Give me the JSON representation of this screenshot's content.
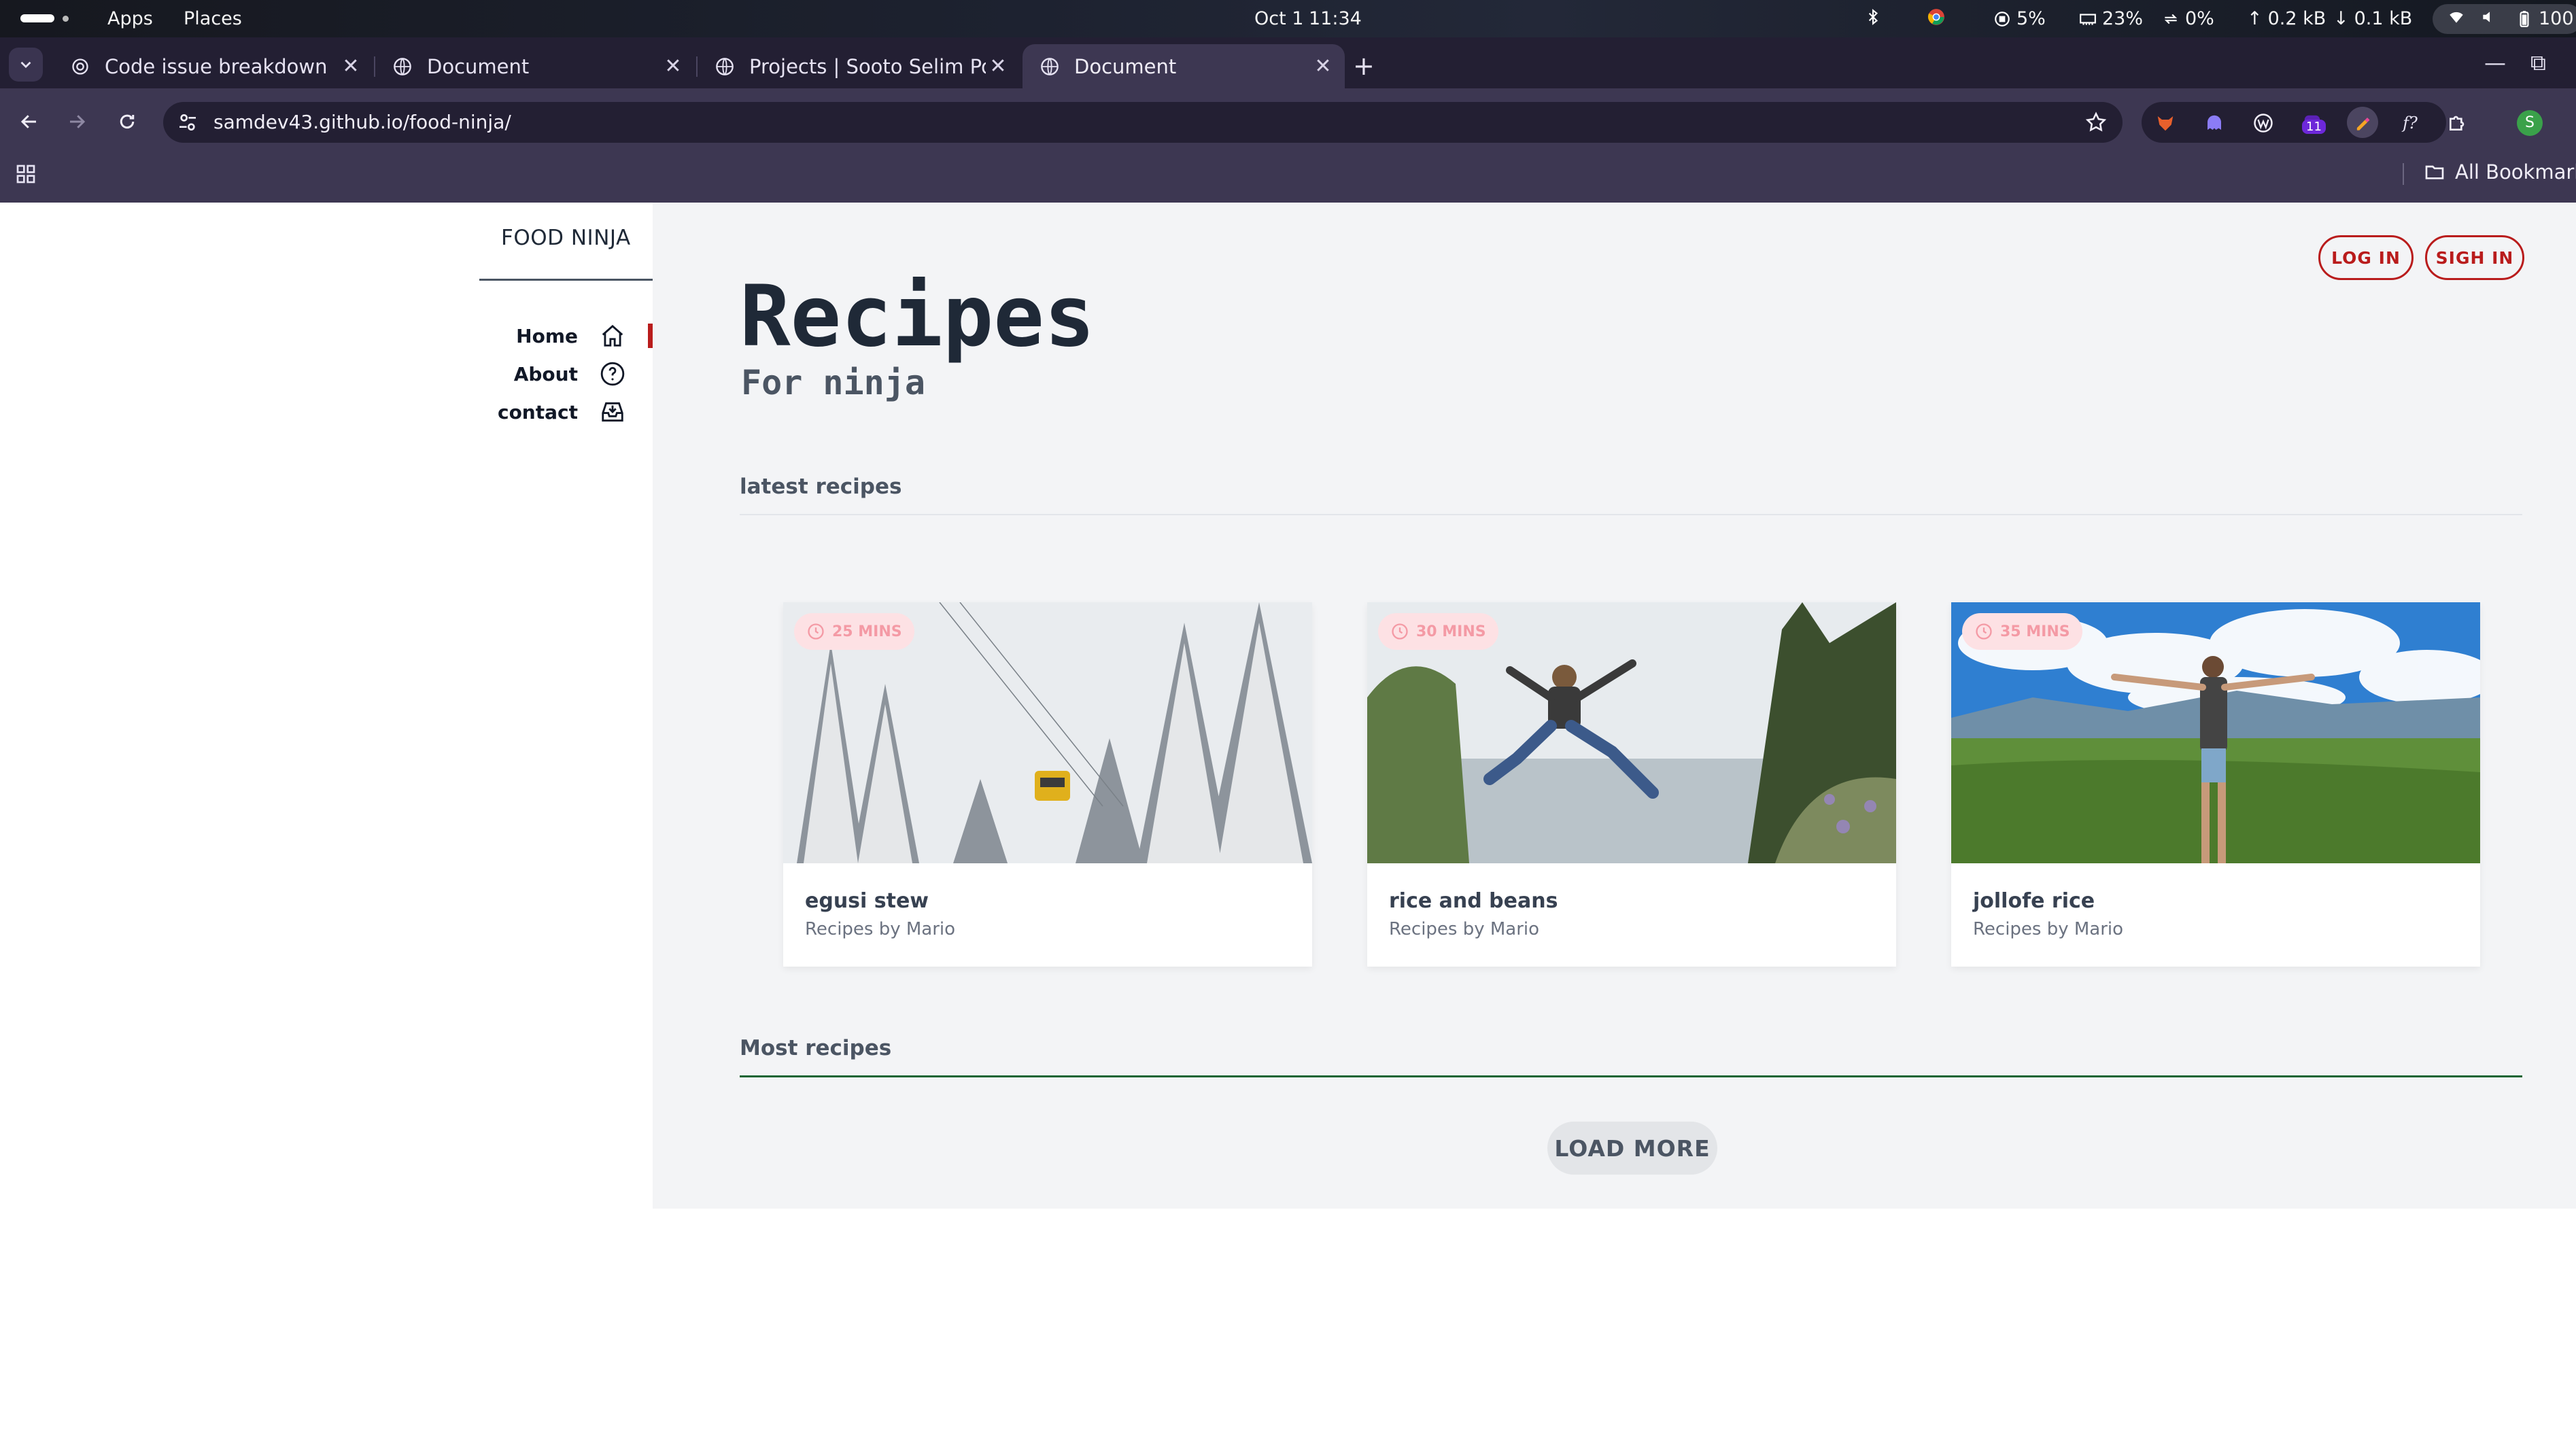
{
  "os_bar": {
    "apps": "Apps",
    "places": "Places",
    "date": "Oct 1",
    "time": "11:34",
    "cpu": "5%",
    "memory": "23%",
    "swap": "0%",
    "upload": "0.2 kB",
    "download": "0.1 kB",
    "battery": "100"
  },
  "browser": {
    "tabs": [
      {
        "title": "Code issue breakdown",
        "active": false
      },
      {
        "title": "Document",
        "active": false
      },
      {
        "title": "Projects | Sooto Selim Po",
        "active": false
      },
      {
        "title": "Document",
        "active": true
      }
    ],
    "url": "samdev43.github.io/food-ninja/",
    "extension_badge": "11",
    "profile_initial": "S",
    "all_bookmarks": "All Bookmarks"
  },
  "site": {
    "brand": "FOOD NINJA",
    "nav": [
      {
        "label": "Home",
        "icon": "home-icon",
        "active": true
      },
      {
        "label": "About",
        "icon": "help-circle-icon",
        "active": false
      },
      {
        "label": "contact",
        "icon": "inbox-icon",
        "active": false
      }
    ],
    "login_label": "LOG IN",
    "signin_label": "SIGH IN",
    "title": "Recipes",
    "subtitle": "For ninja",
    "latest_heading": "latest recipes",
    "most_heading": "Most recipes",
    "load_more": "LOAD MORE",
    "accent_color": "#b91c1c",
    "recipes": [
      {
        "time": "25 MINS",
        "title": "egusi stew",
        "author": "Recipes by Mario",
        "image": "snowy-forest-cable-car"
      },
      {
        "time": "30 MINS",
        "title": "rice and beans",
        "author": "Recipes by Mario",
        "image": "person-jumping-lake"
      },
      {
        "time": "35 MINS",
        "title": "jollofe rice",
        "author": "Recipes by Mario",
        "image": "person-mountain-view"
      }
    ]
  }
}
